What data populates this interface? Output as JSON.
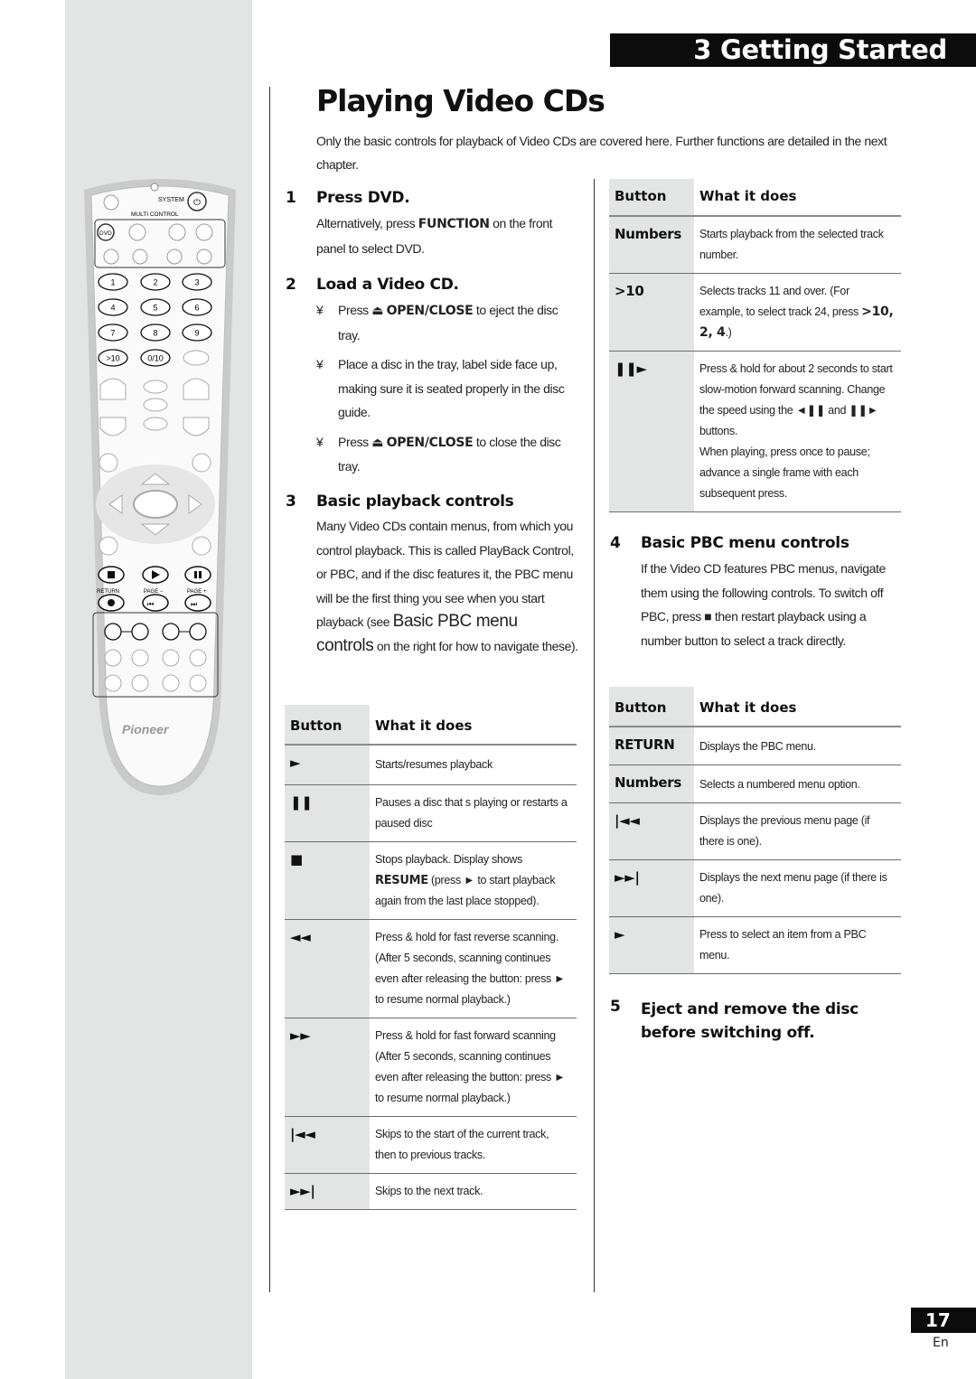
{
  "header": {
    "chapter": "3 Getting Started",
    "page_title": "Playing Video CDs",
    "intro": "Only the basic controls for playback of Video CDs are covered here. Further functions are detailed in the next chapter."
  },
  "remote": {
    "system_label": "SYSTEM",
    "multi_control_label": "MULTI CONTROL",
    "dvd_label": "DVD",
    "number_keys": [
      "1",
      "2",
      "3",
      "4",
      "5",
      "6",
      "7",
      "8",
      "9",
      ">10",
      "0/10"
    ],
    "return_label": "RETURN",
    "page_minus_label": "PAGE −",
    "page_plus_label": "PAGE +",
    "brand": "Pioneer"
  },
  "steps": {
    "s1": {
      "num": "1",
      "title": "Press DVD.",
      "text_a": "Alternatively, press ",
      "bold": "FUNCTION",
      "text_b": " on the front panel to select DVD."
    },
    "s2": {
      "num": "2",
      "title": "Load a Video CD.",
      "bullet": "¥",
      "b1_a": "Press ",
      "b1_eject": "⏏",
      "b1_bold": "OPEN/CLOSE",
      "b1_b": " to eject the disc tray.",
      "b2": "Place a disc in the tray, label side face up, making sure it is seated properly in the disc guide.",
      "b3_a": "Press ",
      "b3_eject": "⏏",
      "b3_bold": "OPEN/CLOSE",
      "b3_b": " to close the disc tray."
    },
    "s3": {
      "num": "3",
      "title": "Basic playback controls",
      "text_a": "Many Video CDs contain menus, from which you control playback. This is called PlayBack Control, or PBC, and if the disc features it, the PBC menu will be the first thing you see when you start playback (see ",
      "xref": "Basic PBC menu controls",
      "text_b": " on the right for how to navigate these)."
    },
    "s4": {
      "num": "4",
      "title": "Basic PBC menu controls",
      "text_a": "If the Video CD features PBC menus, navigate them using the following controls. To switch off PBC, press ",
      "stop_sym": "■",
      "text_b": " then restart playback using a number button to select a track directly."
    },
    "s5": {
      "num": "5",
      "title": "Eject and remove the disc before switching off."
    }
  },
  "table_playback": {
    "col_button": "Button",
    "col_what": "What it does",
    "rows": [
      {
        "button": "►",
        "desc": "Starts/resumes playback"
      },
      {
        "button": "❚❚",
        "desc": "Pauses a disc that s playing or restarts a paused disc"
      },
      {
        "button": "■",
        "desc_a": "Stops playback. Display shows ",
        "desc_bold": "RESUME",
        "desc_b": " (press ► to start playback again from the last place stopped)."
      },
      {
        "button": "◄◄",
        "desc": "Press & hold for fast reverse scanning. (After 5 seconds, scanning continues even after releasing the button: press ► to resume normal playback.)"
      },
      {
        "button": "►►",
        "desc": "Press & hold for fast forward scanning (After 5 seconds, scanning continues even after releasing the button: press ► to resume normal playback.)"
      },
      {
        "button": "|◄◄",
        "desc": "Skips to the start of the current track, then to previous tracks."
      },
      {
        "button": "►►|",
        "desc": "Skips to the next track."
      }
    ]
  },
  "table_tracks": {
    "col_button": "Button",
    "col_what": "What it does",
    "rows": [
      {
        "button": "Numbers",
        "desc": "Starts playback from the selected track number."
      },
      {
        "button": ">10",
        "desc_a": "Selects tracks 11 and over. (For example, to select track 24, press ",
        "desc_bold": ">10, 2, 4",
        "desc_b": ".)"
      },
      {
        "button": "❚❚►",
        "desc": "Press & hold for about 2 seconds to start slow-motion forward scanning. Change the speed using the ◄❚❚ and ❚❚► buttons.",
        "desc_2": "When playing, press once to pause; advance a single frame with each subsequent press."
      }
    ]
  },
  "table_pbc": {
    "col_button": "Button",
    "col_what": "What it does",
    "rows": [
      {
        "button": "RETURN",
        "desc": "Displays the PBC menu."
      },
      {
        "button": "Numbers",
        "desc": "Selects a numbered menu option."
      },
      {
        "button": "|◄◄",
        "desc": "Displays the previous menu page (if there is one)."
      },
      {
        "button": "►►|",
        "desc": "Displays the next menu page (if there is one)."
      },
      {
        "button": "►",
        "desc": "Press to select an item from a PBC menu."
      }
    ]
  },
  "footer": {
    "page_number": "17",
    "language": "En"
  }
}
